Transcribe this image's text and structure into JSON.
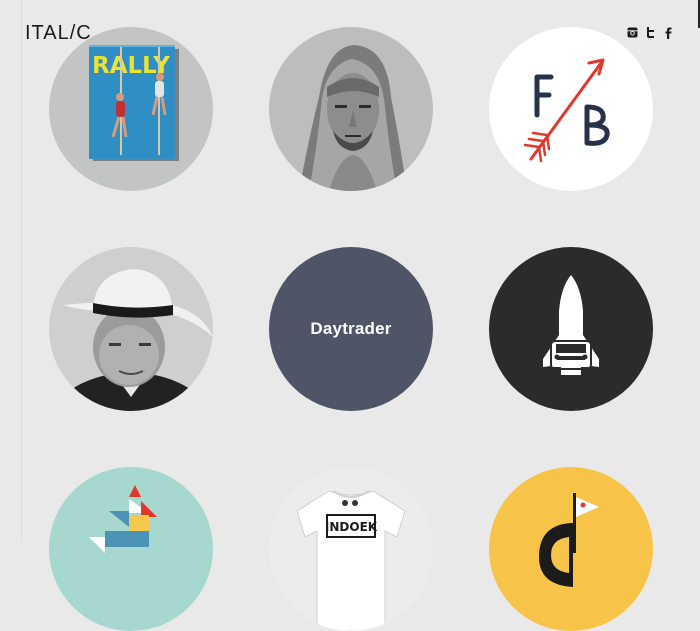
{
  "site": {
    "logo": "ITAL/C"
  },
  "social": [
    {
      "name": "instagram-icon"
    },
    {
      "name": "twitter-icon"
    },
    {
      "name": "facebook-icon"
    }
  ],
  "magazine": {
    "masthead": "RALLY"
  },
  "daytrader": {
    "label": "Daytrader",
    "bg": "#4f5566"
  },
  "tshirt": {
    "print": "INDOEK"
  },
  "colors": {
    "page_bg": "#e9e9e9",
    "mint": "#a6d8cf",
    "yellow": "#f7c349",
    "dark": "#2b2b2b",
    "red": "#e3372b",
    "navy": "#26314a"
  }
}
